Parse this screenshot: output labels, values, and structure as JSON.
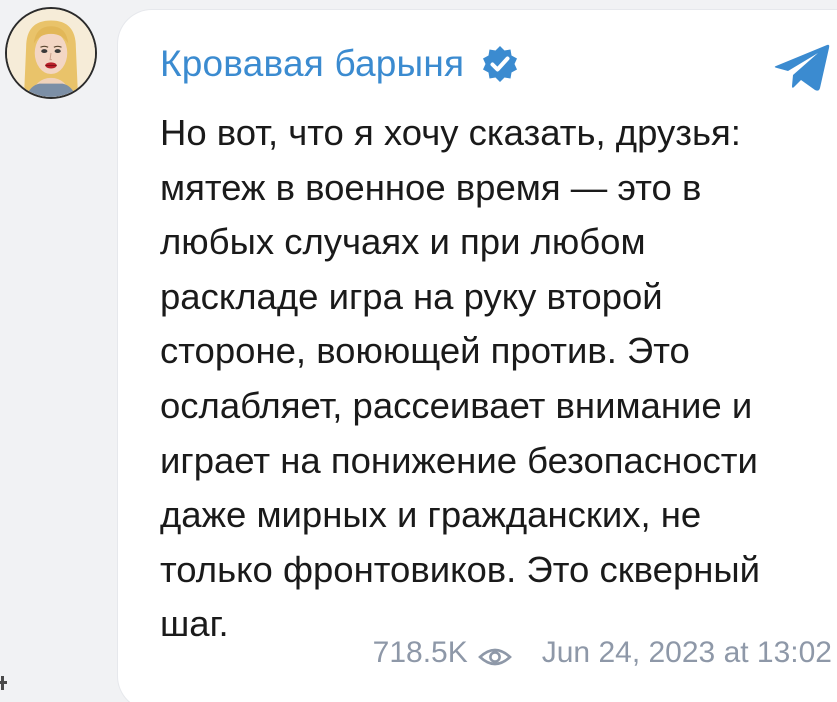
{
  "post": {
    "channel_name": "Кровавая барыня",
    "lines": [
      "Но вот, что я хочу сказать, друзья:",
      "мятеж в военное время — это в",
      "любых случаях и при любом",
      "раскладе игра на руку второй",
      "стороне, воюющей против. Это",
      "ослабляет, рассеивает внимание и",
      "играет на понижение безопасности",
      "даже мирных и гражданских, не",
      "только фронтовиков. Это скверный",
      "шаг."
    ],
    "views": "718.5K",
    "date": "Jun 24, 2023 at 13:02"
  },
  "icons": {
    "verified": "verified-badge-icon",
    "platform": "telegram-icon",
    "views": "eye-icon"
  },
  "colors": {
    "accent": "#3b8bd0",
    "text": "#1a1a1a",
    "meta": "#8e98a8",
    "background": "#f1f2f4",
    "bubble": "#ffffff"
  }
}
